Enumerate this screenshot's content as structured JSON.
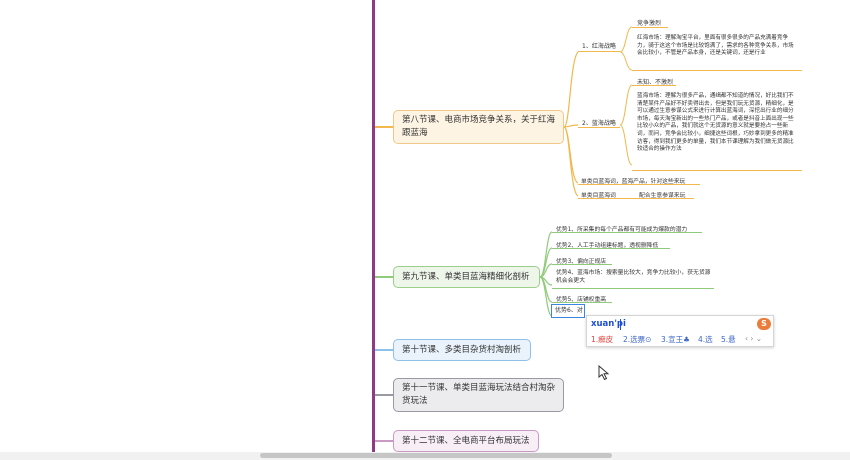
{
  "colors": {
    "trunk": "#8e3b84",
    "orange_branch": "#f2b74d",
    "green_branch": "#8fcb7a",
    "blue_branch": "#8ec0ea",
    "gray_branch": "#9a9aa3",
    "purple_branch": "#c99bc4",
    "ime_candidate": "#3d67c9",
    "ime_selected": "#e0413a"
  },
  "lesson8": {
    "title": "第八节课、电商市场竞争关系，关于红海跟蓝海",
    "red_label": "1、红海战略",
    "red_note": "竞争激烈",
    "red_para": "红海市场：理解淘宝平台，里面有很多很多的产品充满着竞争力，骑于这这个市场是比较饱满了，需求的各种竞争关系，市场会比较小，不管是产品本身，还是关键词，还是行业",
    "blue_label": "2、蓝海战略",
    "blue_note": "未知、不激烈",
    "blue_para": "蓝海市场：理解为很多产品，通缉都不知道的情况，好比我们不清楚某件产品好不好卖得出去，但是我们玩无货源，精细化，是可以通过生意参谋公式来进行计算出蓝海词，深挖出行业的细分市场，每天淘宝新出的一些热门产品，或者是抖音上面出现一些比较小众的产品，我们就这个无货源的意义就是要抢占一些新词，而问，竞争会比较小，细捷这些词根，巧妙拿到更多的精准访客，得到我们更多的单量，我们本节课理解为我们做无货源比较适合的操作方法",
    "leaf1": "单类目蓝海词，蓝海产品，针对这些来玩",
    "leaf2": "单类目蓝海词",
    "leaf2b": "配合生意参谋来玩"
  },
  "lesson9": {
    "title": "第九节课、单类目蓝海精细化剖析",
    "items": [
      "优势1、所采集的每个产品都有可能成为爆款的潜力",
      "优势2、人工手动组建标题，透视删降低",
      "优势3、偏向正规店",
      "优势4、蓝海市场：搜索量比较大，竞争力比较小，获无货源机会会更大",
      "优势5、店铺权重高",
      "优势6、对"
    ]
  },
  "lesson10": {
    "title": "第十节课、多类目杂货村淘剖析"
  },
  "lesson11": {
    "title": "第十一节课、单类目蓝海玩法结合村淘杂货玩法"
  },
  "lesson12": {
    "title": "第十二节课、全电商平台布局玩法"
  },
  "ime": {
    "input": "xuan'pi",
    "logo": "S",
    "candidates": [
      "1.癣皮",
      "2.选票⊙",
      "3.宣王♣",
      "4.选",
      "5.悬"
    ],
    "paging": "‹ › ⌄"
  }
}
